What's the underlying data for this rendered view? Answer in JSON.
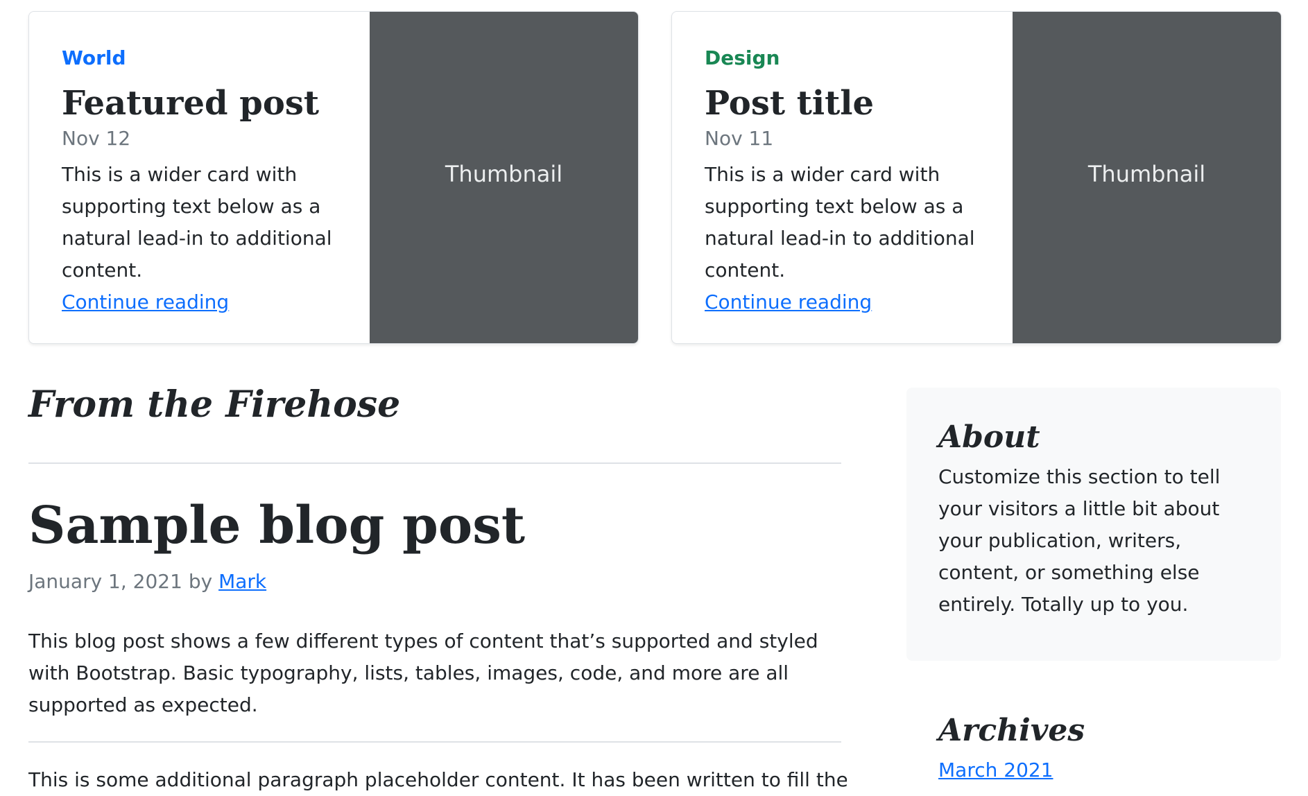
{
  "featured": [
    {
      "category": "World",
      "category_color": "#0d6efd",
      "title": "Featured post",
      "date": "Nov 12",
      "text": "This is a wider card with supporting text below as a natural lead-in to additional content.",
      "link": "Continue reading",
      "thumbnail": "Thumbnail"
    },
    {
      "category": "Design",
      "category_color": "#198754",
      "title": "Post title",
      "date": "Nov 11",
      "text": "This is a wider card with supporting text below as a natural lead-in to additional content.",
      "link": "Continue reading",
      "thumbnail": "Thumbnail"
    }
  ],
  "main": {
    "section_title": "From the Firehose",
    "post": {
      "title": "Sample blog post",
      "date_prefix": "January 1, 2021 by ",
      "author": "Mark",
      "intro": "This blog post shows a few different types of content that’s supported and styled with Bootstrap. Basic typography, lists, tables, images, code, and more are all supported as expected.",
      "extra": "This is some additional paragraph placeholder content. It has been written to fill the"
    }
  },
  "sidebar": {
    "about_title": "About",
    "about_text": "Customize this section to tell your visitors a little bit about your publication, writers, content, or something else entirely. Totally up to you.",
    "archives_title": "Archives",
    "archives": [
      "March 2021"
    ]
  },
  "colors": {
    "link": "#0d6efd",
    "muted": "#6c757d",
    "thumbnail_bg": "#55595c",
    "sidebar_bg": "#f8f9fa"
  }
}
